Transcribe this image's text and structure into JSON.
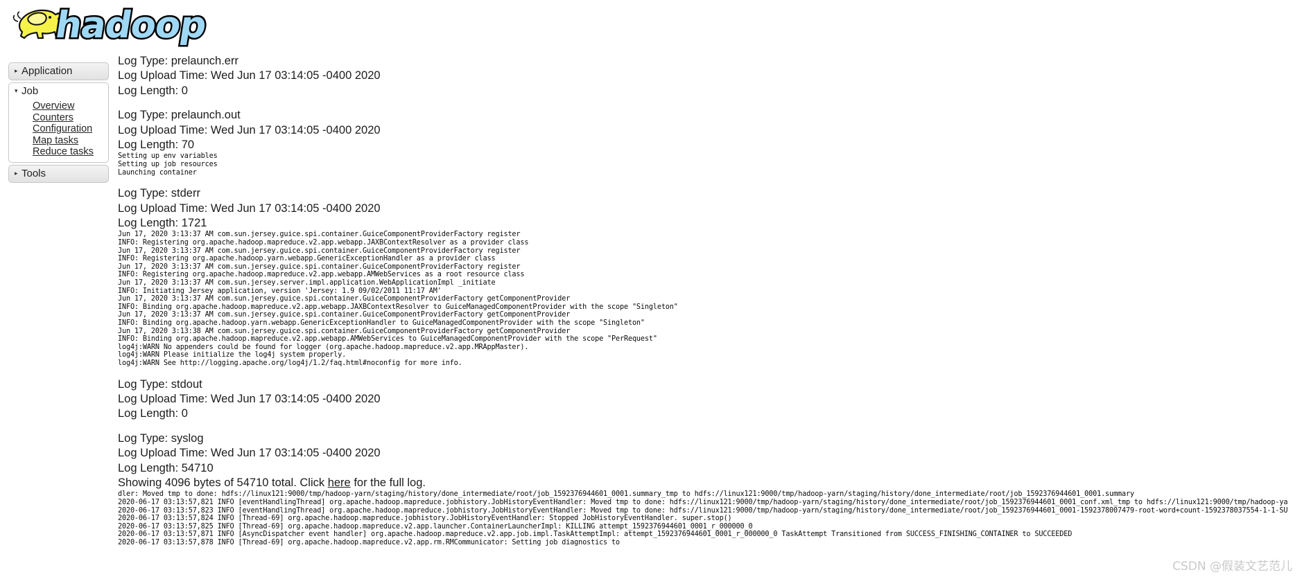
{
  "header": {
    "logo_alt": "hadoop",
    "logo_text": "hadoop",
    "logo_colors": {
      "elephant": "#f5f24a",
      "wordmark": "#9ed8f5",
      "outline": "#000000"
    }
  },
  "sidebar": {
    "sections": [
      {
        "label": "Application",
        "expanded": false,
        "icon": "chevron-right-icon",
        "items": []
      },
      {
        "label": "Job",
        "expanded": true,
        "icon": "chevron-down-icon",
        "items": [
          {
            "label": "Overview"
          },
          {
            "label": "Counters"
          },
          {
            "label": "Configuration"
          },
          {
            "label": "Map tasks"
          },
          {
            "label": "Reduce tasks"
          }
        ]
      },
      {
        "label": "Tools",
        "expanded": false,
        "icon": "chevron-right-icon",
        "items": []
      }
    ]
  },
  "logs": [
    {
      "type_line": "Log Type: prelaunch.err",
      "upload_line": "Log Upload Time: Wed Jun 17 03:14:05 -0400 2020",
      "length_line": "Log Length: 0",
      "body": ""
    },
    {
      "type_line": "Log Type: prelaunch.out",
      "upload_line": "Log Upload Time: Wed Jun 17 03:14:05 -0400 2020",
      "length_line": "Log Length: 70",
      "body": "Setting up env variables\nSetting up job resources\nLaunching container"
    },
    {
      "type_line": "Log Type: stderr",
      "upload_line": "Log Upload Time: Wed Jun 17 03:14:05 -0400 2020",
      "length_line": "Log Length: 1721",
      "body": "Jun 17, 2020 3:13:37 AM com.sun.jersey.guice.spi.container.GuiceComponentProviderFactory register\nINFO: Registering org.apache.hadoop.mapreduce.v2.app.webapp.JAXBContextResolver as a provider class\nJun 17, 2020 3:13:37 AM com.sun.jersey.guice.spi.container.GuiceComponentProviderFactory register\nINFO: Registering org.apache.hadoop.yarn.webapp.GenericExceptionHandler as a provider class\nJun 17, 2020 3:13:37 AM com.sun.jersey.guice.spi.container.GuiceComponentProviderFactory register\nINFO: Registering org.apache.hadoop.mapreduce.v2.app.webapp.AMWebServices as a root resource class\nJun 17, 2020 3:13:37 AM com.sun.jersey.server.impl.application.WebApplicationImpl _initiate\nINFO: Initiating Jersey application, version 'Jersey: 1.9 09/02/2011 11:17 AM'\nJun 17, 2020 3:13:37 AM com.sun.jersey.guice.spi.container.GuiceComponentProviderFactory getComponentProvider\nINFO: Binding org.apache.hadoop.mapreduce.v2.app.webapp.JAXBContextResolver to GuiceManagedComponentProvider with the scope \"Singleton\"\nJun 17, 2020 3:13:37 AM com.sun.jersey.guice.spi.container.GuiceComponentProviderFactory getComponentProvider\nINFO: Binding org.apache.hadoop.yarn.webapp.GenericExceptionHandler to GuiceManagedComponentProvider with the scope \"Singleton\"\nJun 17, 2020 3:13:38 AM com.sun.jersey.guice.spi.container.GuiceComponentProviderFactory getComponentProvider\nINFO: Binding org.apache.hadoop.mapreduce.v2.app.webapp.AMWebServices to GuiceManagedComponentProvider with the scope \"PerRequest\"\nlog4j:WARN No appenders could be found for logger (org.apache.hadoop.mapreduce.v2.app.MRAppMaster).\nlog4j:WARN Please initialize the log4j system properly.\nlog4j:WARN See http://logging.apache.org/log4j/1.2/faq.html#noconfig for more info."
    },
    {
      "type_line": "Log Type: stdout",
      "upload_line": "Log Upload Time: Wed Jun 17 03:14:05 -0400 2020",
      "length_line": "Log Length: 0",
      "body": ""
    },
    {
      "type_line": "Log Type: syslog",
      "upload_line": "Log Upload Time: Wed Jun 17 03:14:05 -0400 2020",
      "length_line": "Log Length: 54710",
      "showing": {
        "prefix": "Showing 4096 bytes of 54710 total. Click ",
        "link": "here",
        "suffix": " for the full log."
      },
      "body": "dler: Moved tmp to done: hdfs://linux121:9000/tmp/hadoop-yarn/staging/history/done_intermediate/root/job_1592376944601_0001.summary_tmp to hdfs://linux121:9000/tmp/hadoop-yarn/staging/history/done_intermediate/root/job_1592376944601_0001.summary\n2020-06-17 03:13:57,821 INFO [eventHandlingThread] org.apache.hadoop.mapreduce.jobhistory.JobHistoryEventHandler: Moved tmp to done: hdfs://linux121:9000/tmp/hadoop-yarn/staging/history/done_intermediate/root/job_1592376944601_0001_conf.xml_tmp to hdfs://linux121:9000/tmp/hadoop-ya\n2020-06-17 03:13:57,823 INFO [eventHandlingThread] org.apache.hadoop.mapreduce.jobhistory.JobHistoryEventHandler: Moved tmp to done: hdfs://linux121:9000/tmp/hadoop-yarn/staging/history/done_intermediate/root/job_1592376944601_0001-1592378007479-root-word+count-1592378037554-1-1-SU\n2020-06-17 03:13:57,824 INFO [Thread-69] org.apache.hadoop.mapreduce.jobhistory.JobHistoryEventHandler: Stopped JobHistoryEventHandler. super.stop()\n2020-06-17 03:13:57,825 INFO [Thread-69] org.apache.hadoop.mapreduce.v2.app.launcher.ContainerLauncherImpl: KILLING attempt_1592376944601_0001_r_000000_0\n2020-06-17 03:13:57,871 INFO [AsyncDispatcher event handler] org.apache.hadoop.mapreduce.v2.app.job.impl.TaskAttemptImpl: attempt_1592376944601_0001_r_000000_0 TaskAttempt Transitioned from SUCCESS_FINISHING_CONTAINER to SUCCEEDED\n2020-06-17 03:13:57,878 INFO [Thread-69] org.apache.hadoop.mapreduce.v2.app.rm.RMCommunicator: Setting job diagnostics to"
    }
  ],
  "watermark": "CSDN @假装文艺范儿"
}
